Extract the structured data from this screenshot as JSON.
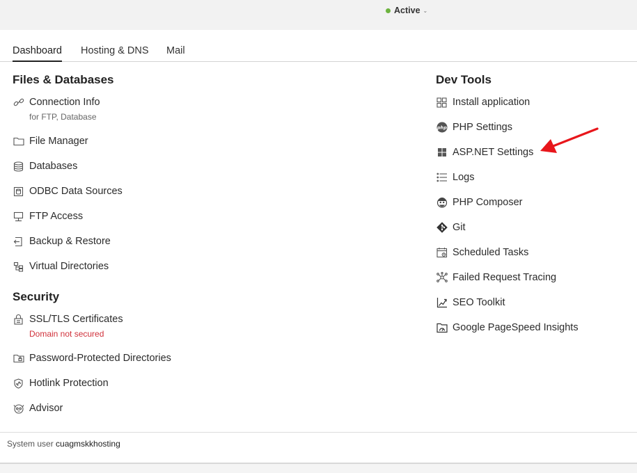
{
  "header": {
    "status_label": "Active"
  },
  "tabs": [
    {
      "label": "Dashboard",
      "active": true
    },
    {
      "label": "Hosting & DNS",
      "active": false
    },
    {
      "label": "Mail",
      "active": false
    }
  ],
  "files": {
    "title": "Files & Databases",
    "items": [
      {
        "label": "Connection Info",
        "sub": "for FTP, Database",
        "icon": "link-icon"
      },
      {
        "label": "File Manager",
        "icon": "folder-icon"
      },
      {
        "label": "Databases",
        "icon": "database-icon"
      },
      {
        "label": "ODBC Data Sources",
        "icon": "odbc-icon"
      },
      {
        "label": "FTP Access",
        "icon": "ftp-icon"
      },
      {
        "label": "Backup & Restore",
        "icon": "backup-icon"
      },
      {
        "label": "Virtual Directories",
        "icon": "virtual-directories-icon"
      }
    ]
  },
  "security": {
    "title": "Security",
    "items": [
      {
        "label": "SSL/TLS Certificates",
        "sub": "Domain not secured",
        "icon": "lock-icon"
      },
      {
        "label": "Password-Protected Directories",
        "icon": "protected-folder-icon"
      },
      {
        "label": "Hotlink Protection",
        "icon": "shield-icon"
      },
      {
        "label": "Advisor",
        "icon": "advisor-icon"
      }
    ]
  },
  "devtools": {
    "title": "Dev Tools",
    "items": [
      {
        "label": "Install application",
        "icon": "grid-icon"
      },
      {
        "label": "PHP Settings",
        "icon": "php-icon"
      },
      {
        "label": "ASP.NET Settings",
        "icon": "windows-icon"
      },
      {
        "label": "Logs",
        "icon": "list-icon"
      },
      {
        "label": "PHP Composer",
        "icon": "composer-icon"
      },
      {
        "label": "Git",
        "icon": "git-icon"
      },
      {
        "label": "Scheduled Tasks",
        "icon": "calendar-icon"
      },
      {
        "label": "Failed Request Tracing",
        "icon": "tracing-icon"
      },
      {
        "label": "SEO Toolkit",
        "icon": "chart-icon"
      },
      {
        "label": "Google PageSpeed Insights",
        "icon": "pagespeed-icon"
      }
    ]
  },
  "footer": {
    "prefix": "System user",
    "username": "cuagmskkhosting"
  },
  "colors": {
    "accent_arrow": "#e8161b",
    "status_dot": "#6db33f",
    "danger": "#d0303a"
  }
}
